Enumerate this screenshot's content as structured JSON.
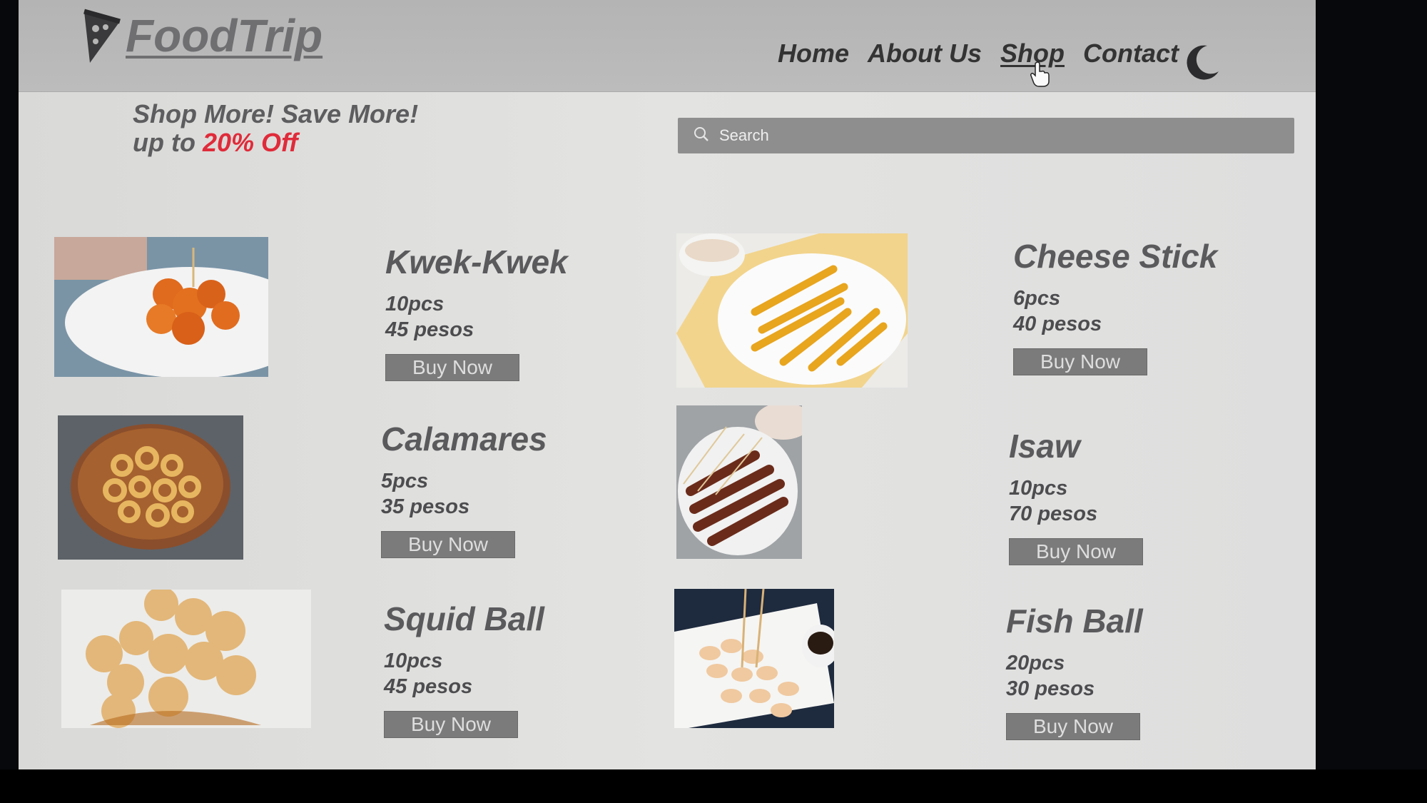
{
  "header": {
    "brand": "FoodTrip",
    "nav": [
      {
        "label": "Home"
      },
      {
        "label": "About Us"
      },
      {
        "label": "Shop"
      },
      {
        "label": "Contact"
      }
    ],
    "active_nav": "Shop",
    "theme_toggle_icon": "moon-icon"
  },
  "promo": {
    "line1": "Shop More! Save More!",
    "line2_prefix": "up to",
    "discount": "20% Off"
  },
  "search": {
    "placeholder": "Search",
    "value": ""
  },
  "products": [
    {
      "name": "Kwek-Kwek",
      "qty": "10pcs",
      "price": "45 pesos",
      "button": "Buy Now",
      "image": "kwek-kwek-photo"
    },
    {
      "name": "Cheese Stick",
      "qty": "6pcs",
      "price": "40 pesos",
      "button": "Buy Now",
      "image": "cheese-stick-photo"
    },
    {
      "name": "Calamares",
      "qty": "5pcs",
      "price": "35 pesos",
      "button": "Buy Now",
      "image": "calamares-photo"
    },
    {
      "name": "Isaw",
      "qty": "10pcs",
      "price": "70 pesos",
      "button": "Buy Now",
      "image": "isaw-photo"
    },
    {
      "name": "Squid Ball",
      "qty": "10pcs",
      "price": "45 pesos",
      "button": "Buy Now",
      "image": "squid-ball-photo"
    },
    {
      "name": "Fish Ball",
      "qty": "20pcs",
      "price": "30 pesos",
      "button": "Buy Now",
      "image": "fish-ball-photo"
    }
  ],
  "colors": {
    "navbar": "#b5b5b5",
    "page_bg": "#e0e0de",
    "discount": "#e02b3a",
    "button": "#7b7b7b",
    "search_bg": "#8e8e8e"
  }
}
